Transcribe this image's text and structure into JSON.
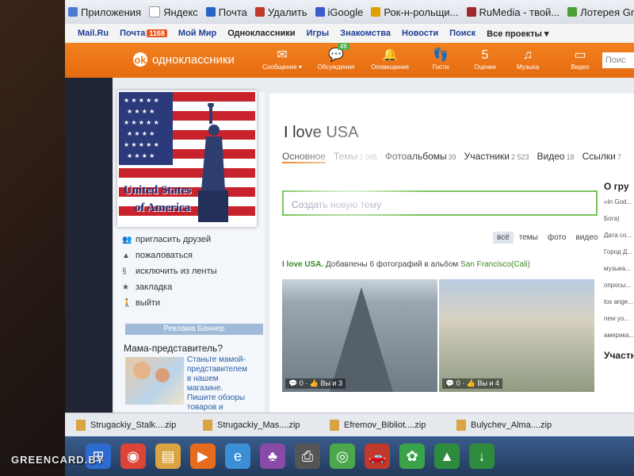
{
  "bookmarks": [
    {
      "label": "Приложения",
      "color": "#4a7bd0"
    },
    {
      "label": "Яндекс",
      "color": "#dddddd"
    },
    {
      "label": "Почта",
      "color": "#2a63c7"
    },
    {
      "label": "Удалить",
      "color": "#c03a2b"
    },
    {
      "label": "iGoogle",
      "color": "#3b5bd1"
    },
    {
      "label": "Рок-н-рольщи...",
      "color": "#e0a000"
    },
    {
      "label": "RuMedia - твой...",
      "color": "#a0282a"
    },
    {
      "label": "Лотерея Gr...",
      "color": "#4a9e34"
    }
  ],
  "mailru": {
    "items": [
      "Mail.Ru",
      "Почта",
      "Мой Мир",
      "Одноклассники",
      "Игры",
      "Знакомства",
      "Новости",
      "Поиск",
      "Все проекты ▾"
    ],
    "mail_badge": "1168"
  },
  "ok": {
    "brand": "одноклассники",
    "nav": [
      {
        "label": "Сообщения ▾",
        "icon": "envelope-icon",
        "glyph": "✉"
      },
      {
        "label": "Обсуждения",
        "icon": "chat-icon",
        "glyph": "💬",
        "count": "46"
      },
      {
        "label": "Оповещения",
        "icon": "bell-icon",
        "glyph": "🔔"
      },
      {
        "label": "Гости",
        "icon": "footprints-icon",
        "glyph": "👣"
      },
      {
        "label": "Оценки",
        "icon": "rating-icon",
        "glyph": "5"
      },
      {
        "label": "Музыка",
        "icon": "music-icon",
        "glyph": "♫"
      },
      {
        "label": "Видео",
        "icon": "video-icon",
        "glyph": "▭"
      }
    ],
    "search_placeholder": "Поис"
  },
  "group": {
    "title": "I love USA",
    "avatar_text": [
      "United States",
      "of America"
    ],
    "tabs": [
      {
        "label": "Основное",
        "count": ""
      },
      {
        "label": "Темы",
        "count": "1 065"
      },
      {
        "label": "Фотоальбомы",
        "count": "39"
      },
      {
        "label": "Участники",
        "count": "2 523"
      },
      {
        "label": "Видео",
        "count": "18"
      },
      {
        "label": "Ссылки",
        "count": "7"
      }
    ],
    "new_topic_placeholder": "Создать новую тему",
    "filters": [
      "всё",
      "темы",
      "фото",
      "видео"
    ],
    "feed": {
      "group_name": "I love USA.",
      "text": "Добавлены 6 фотографий в альбом",
      "album": "San Francisco(Cali)"
    },
    "photos": [
      {
        "comments": "0",
        "likes": "Вы и 3"
      },
      {
        "comments": "0",
        "likes": "Вы и 4"
      }
    ]
  },
  "sidebar": {
    "menu": [
      {
        "label": "пригласить друзей",
        "icon": "friends-icon",
        "glyph": "👥"
      },
      {
        "label": "пожаловаться",
        "icon": "warning-icon",
        "glyph": "▲"
      },
      {
        "label": "исключить из ленты",
        "icon": "exclude-icon",
        "glyph": "§"
      },
      {
        "label": "закладка",
        "icon": "star-icon",
        "glyph": "★"
      },
      {
        "label": "выйти",
        "icon": "exit-icon",
        "glyph": "🚶"
      }
    ],
    "ad_label": "Реклама Баннер",
    "promo_title": "Мама-представитель?",
    "promo_text": "Станьте мамой-представителем в нашем магазине. Пишите обзоры товаров и получайте деньги"
  },
  "right": {
    "heading": "О гру",
    "items": [
      "«In God...",
      "Бога)",
      "Дата со...",
      "Город Д...",
      "музыка...",
      "опросы...",
      "los ange...",
      "new yo...",
      "америка..."
    ],
    "bottom": "Участн"
  },
  "downloads": [
    "Strugackiy_Stalk....zip",
    "Strugackiy_Mas....zip",
    "Efremov_Bibliot....zip",
    "Bulychev_Alma....zip"
  ],
  "taskbar": [
    {
      "icon": "start-icon",
      "glyph": "⊞",
      "color": "#2d6bd1"
    },
    {
      "icon": "chrome-icon",
      "glyph": "◉",
      "color": "#dc4437"
    },
    {
      "icon": "explorer-icon",
      "glyph": "▤",
      "color": "#d9a441"
    },
    {
      "icon": "media-player-icon",
      "glyph": "▶",
      "color": "#e86a1c"
    },
    {
      "icon": "ie-icon",
      "glyph": "e",
      "color": "#3b8fd6"
    },
    {
      "icon": "games-icon",
      "glyph": "♣",
      "color": "#8a4aa8"
    },
    {
      "icon": "printer-icon",
      "glyph": "⎙",
      "color": "#555555"
    },
    {
      "icon": "maps-icon",
      "glyph": "◎",
      "color": "#4aa84a"
    },
    {
      "icon": "car-icon",
      "glyph": "🚗",
      "color": "#c0392b"
    },
    {
      "icon": "icq-icon",
      "glyph": "✿",
      "color": "#3aa34a"
    },
    {
      "icon": "tree-icon",
      "glyph": "▲",
      "color": "#2e8b3e"
    },
    {
      "icon": "download-icon",
      "glyph": "↓",
      "color": "#2e8b3e"
    }
  ],
  "watermark": "GREENCARD.BY"
}
